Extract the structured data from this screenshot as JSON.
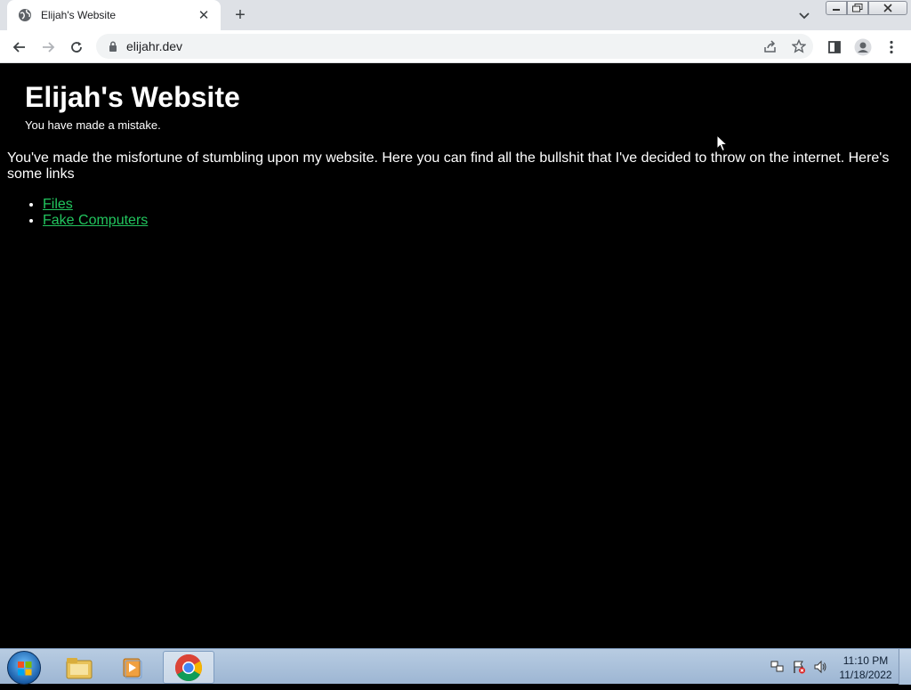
{
  "browser": {
    "tab_title": "Elijah's Website",
    "tab_close": "✕",
    "new_tab": "+",
    "url": "elijahr.dev"
  },
  "page": {
    "title": "Elijah's Website",
    "subtitle": "You have made a mistake.",
    "intro": "You've made the misfortune of stumbling upon my website. Here you can find all the bullshit that I've decided to throw on the internet. Here's some links",
    "links": [
      {
        "label": "Files"
      },
      {
        "label": "Fake Computers"
      }
    ],
    "link_color": "#22c55e"
  },
  "taskbar": {
    "time": "11:10 PM",
    "date": "11/18/2022"
  }
}
